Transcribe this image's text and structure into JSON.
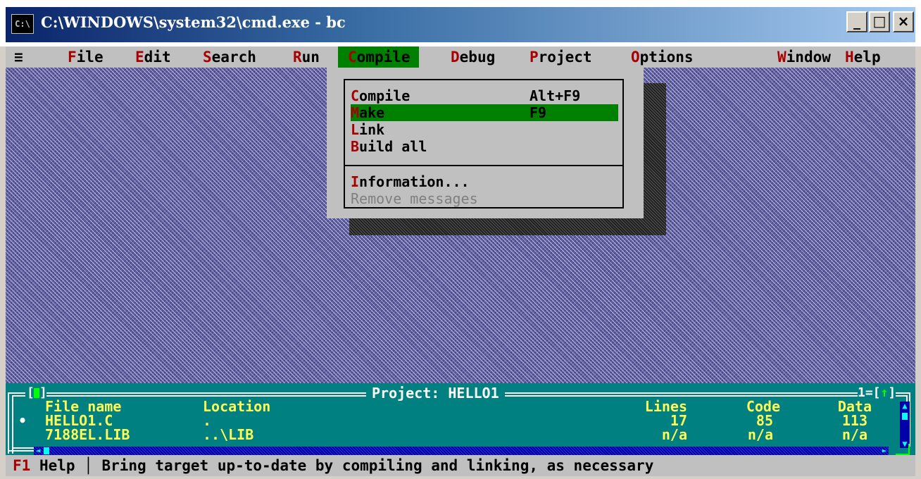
{
  "window": {
    "icon_label": "C:\\",
    "title": "C:\\WINDOWS\\system32\\cmd.exe - bc",
    "controls": {
      "minimize": "_",
      "maximize": "□",
      "close": "×"
    }
  },
  "menubar": {
    "system": "≡",
    "items": [
      {
        "hotkey": "F",
        "rest": "ile"
      },
      {
        "hotkey": "E",
        "rest": "dit"
      },
      {
        "hotkey": "S",
        "rest": "earch"
      },
      {
        "hotkey": "R",
        "rest": "un"
      },
      {
        "hotkey": "C",
        "rest": "ompile"
      },
      {
        "hotkey": "D",
        "rest": "ebug"
      },
      {
        "hotkey": "P",
        "rest": "roject"
      },
      {
        "hotkey": "O",
        "rest": "ptions"
      },
      {
        "hotkey": "W",
        "rest": "indow"
      },
      {
        "hotkey": "H",
        "rest": "elp"
      }
    ],
    "active": "Compile"
  },
  "compile_menu": {
    "items": [
      {
        "hotkey": "C",
        "rest": "ompile",
        "shortcut": "Alt+F9"
      },
      {
        "hotkey": "M",
        "rest": "ake",
        "shortcut": "F9",
        "selected": true
      },
      {
        "hotkey": "L",
        "rest": "ink",
        "shortcut": ""
      },
      {
        "hotkey": "B",
        "rest": "uild all",
        "shortcut": ""
      },
      {
        "hotkey": "I",
        "rest": "nformation...",
        "shortcut": ""
      },
      {
        "hotkey": "",
        "rest": "Remove messages",
        "shortcut": "",
        "disabled": true
      }
    ]
  },
  "project_window": {
    "title": "Project: HELLO1",
    "window_number": "1",
    "columns": [
      "File name",
      "Location",
      "Lines",
      "Code",
      "Data"
    ],
    "rows": [
      {
        "marker": "•",
        "file": "HELLO1.C",
        "location": ".",
        "lines": "17",
        "code": "85",
        "data": "113"
      },
      {
        "marker": "",
        "file": "7188EL.LIB",
        "location": "..\\LIB",
        "lines": "n/a",
        "code": "n/a",
        "data": "n/a"
      }
    ]
  },
  "status_bar": {
    "key": "F1",
    "key_label": "Help",
    "message": "Bring target up-to-date by compiling and linking, as necessary"
  }
}
